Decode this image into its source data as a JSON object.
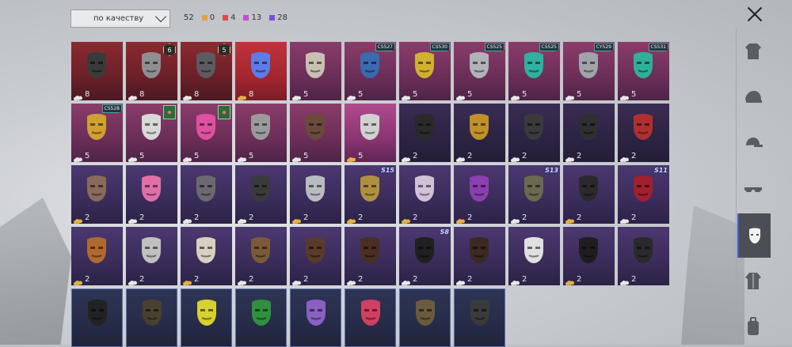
{
  "sort": {
    "label": "по качеству"
  },
  "counts": {
    "total": "52",
    "rarity": [
      {
        "value": "0",
        "color": "#e8a23a"
      },
      {
        "value": "4",
        "color": "#e04a4a"
      },
      {
        "value": "13",
        "color": "#c84ccf"
      },
      {
        "value": "28",
        "color": "#7a4ee0"
      }
    ]
  },
  "sidebar": {
    "categories": [
      {
        "name": "outfit-icon"
      },
      {
        "name": "helmet-icon"
      },
      {
        "name": "cap-icon"
      },
      {
        "name": "glasses-icon"
      },
      {
        "name": "mask-icon",
        "active": true
      },
      {
        "name": "jacket-icon"
      },
      {
        "name": "backpack-icon"
      }
    ]
  },
  "items": [
    {
      "rarity": "red",
      "count": "8",
      "icon": "respirator-mask-icon",
      "tone": "#3a3a3a"
    },
    {
      "rarity": "red",
      "count": "8",
      "icon": "plague-doctor-mask-icon",
      "tone": "#8e8e93",
      "lvl": "6"
    },
    {
      "rarity": "red",
      "count": "8",
      "icon": "gas-mask-icon",
      "tone": "#5b5b60",
      "lvl": "5"
    },
    {
      "rarity": "red-bright",
      "count": "8",
      "icon": "iridescent-mask-icon",
      "tone": "#5e7be8",
      "gold": true
    },
    {
      "rarity": "pink",
      "count": "5",
      "icon": "cat-mask-icon",
      "tone": "#c8c0b0"
    },
    {
      "rarity": "pink",
      "count": "5",
      "icon": "blue-respirator-icon",
      "tone": "#3a6ab0",
      "badge": "CS527"
    },
    {
      "rarity": "pink",
      "count": "5",
      "icon": "yellow-mask-icon",
      "tone": "#d0b030",
      "badge": "CS530"
    },
    {
      "rarity": "pink",
      "count": "5",
      "icon": "silver-mask-icon",
      "tone": "#b0b4b8",
      "badge": "CS525"
    },
    {
      "rarity": "pink",
      "count": "5",
      "icon": "teal-mask-icon",
      "tone": "#2fb0a0",
      "badge": "CS525"
    },
    {
      "rarity": "pink",
      "count": "5",
      "icon": "grey-mask-icon",
      "tone": "#a0a4a8",
      "badge": "CY529"
    },
    {
      "rarity": "pink",
      "count": "5",
      "icon": "green-mask-icon",
      "tone": "#30b098",
      "badge": "CS531"
    },
    {
      "rarity": "pink",
      "count": "5",
      "icon": "yellow-gas-mask-icon",
      "tone": "#d0a030",
      "badge": "CS528"
    },
    {
      "rarity": "pink",
      "count": "5",
      "icon": "x-mask-icon",
      "tone": "#d8d8d8",
      "green": true
    },
    {
      "rarity": "pink",
      "count": "5",
      "icon": "pink-mask-icon",
      "tone": "#e050a0",
      "green": true
    },
    {
      "rarity": "pink",
      "count": "5",
      "icon": "alien-mask-icon",
      "tone": "#9a9a9a"
    },
    {
      "rarity": "pink",
      "count": "5",
      "icon": "brown-mask-icon",
      "tone": "#6a4a38"
    },
    {
      "rarity": "magenta",
      "count": "5",
      "icon": "bandana-icon",
      "tone": "#d0d0d0",
      "gold": true
    },
    {
      "rarity": "purple",
      "count": "2",
      "icon": "black-mask-icon",
      "tone": "#2a2a2a"
    },
    {
      "rarity": "purple",
      "count": "2",
      "icon": "gold-eye-mask-icon",
      "tone": "#c0902a"
    },
    {
      "rarity": "purple",
      "count": "2",
      "icon": "dark-face-mask-icon",
      "tone": "#3a3a3c"
    },
    {
      "rarity": "purple",
      "count": "2",
      "icon": "tactical-mask-icon",
      "tone": "#2f2f32"
    },
    {
      "rarity": "purple",
      "count": "2",
      "icon": "red-eye-mask-icon",
      "tone": "#b03030"
    },
    {
      "rarity": "purple-light",
      "count": "2",
      "icon": "elephant-mask-icon",
      "tone": "#8a6a5a",
      "gold": true
    },
    {
      "rarity": "purple-light",
      "count": "2",
      "icon": "pink-dino-mask-icon",
      "tone": "#e070a8"
    },
    {
      "rarity": "purple-light",
      "count": "2",
      "icon": "hockey-mask-icon",
      "tone": "#6a6a70"
    },
    {
      "rarity": "purple-light",
      "count": "2",
      "icon": "goggle-mask-icon",
      "tone": "#3a3a3a"
    },
    {
      "rarity": "purple-light",
      "count": "2",
      "icon": "white-mask-icon",
      "tone": "#b8bcc0",
      "gold": true
    },
    {
      "rarity": "purple-light",
      "count": "2",
      "icon": "gold-skull-mask-icon",
      "tone": "#b09040",
      "gold": true,
      "season": "S15"
    },
    {
      "rarity": "purple-light",
      "count": "2",
      "icon": "half-mask-icon",
      "tone": "#d0c0d8",
      "gold": true
    },
    {
      "rarity": "purple-light",
      "count": "2",
      "icon": "purple-helmet-mask-icon",
      "tone": "#8a40b0",
      "gold": true
    },
    {
      "rarity": "purple-light",
      "count": "2",
      "icon": "goggles-mask-icon",
      "tone": "#6a6a50",
      "season": "S13"
    },
    {
      "rarity": "purple-light",
      "count": "2",
      "icon": "black-visor-mask-icon",
      "tone": "#2a2a2c",
      "gold": true
    },
    {
      "rarity": "purple-light",
      "count": "2",
      "icon": "red-visor-mask-icon",
      "tone": "#a02030",
      "season": "S11"
    },
    {
      "rarity": "purple-light",
      "count": "2",
      "icon": "copper-mask-icon",
      "tone": "#b06a30",
      "gold": true
    },
    {
      "rarity": "purple-light",
      "count": "2",
      "icon": "striped-mask-icon",
      "tone": "#c0c0c0"
    },
    {
      "rarity": "purple-light",
      "count": "2",
      "icon": "mummy-mask-icon",
      "tone": "#d8d0c0",
      "gold": true
    },
    {
      "rarity": "purple-light",
      "count": "2",
      "icon": "rusty-mask-icon",
      "tone": "#7a5a3a"
    },
    {
      "rarity": "purple-light",
      "count": "2",
      "icon": "leather-mask-icon",
      "tone": "#5a3a2a"
    },
    {
      "rarity": "purple-light",
      "count": "2",
      "icon": "mustache-icon",
      "tone": "#4a2e20"
    },
    {
      "rarity": "purple-light",
      "count": "2",
      "icon": "gold-trim-mask-icon",
      "tone": "#202020",
      "season": "S8"
    },
    {
      "rarity": "purple-light",
      "count": "2",
      "icon": "studded-mask-icon",
      "tone": "#3a2a20"
    },
    {
      "rarity": "purple-light",
      "count": "2",
      "icon": "camo-mask-icon",
      "tone": "#e0e0e0"
    },
    {
      "rarity": "purple-light",
      "count": "2",
      "icon": "black-helmet-mask-icon",
      "tone": "#1e1e20",
      "gold": true
    },
    {
      "rarity": "purple-light",
      "count": "2",
      "icon": "armored-mask-icon",
      "tone": "#2a2a2c"
    },
    {
      "rarity": "blue",
      "count": "",
      "icon": "black-bandana-icon",
      "tone": "#222"
    },
    {
      "rarity": "blue",
      "count": "",
      "icon": "skull-mask-icon",
      "tone": "#4a4030"
    },
    {
      "rarity": "blue",
      "count": "",
      "icon": "yellow-net-mask-icon",
      "tone": "#d8d030"
    },
    {
      "rarity": "blue",
      "count": "",
      "icon": "green-net-mask-icon",
      "tone": "#309040"
    },
    {
      "rarity": "blue",
      "count": "",
      "icon": "purple-theater-mask-icon",
      "tone": "#8a60c0"
    },
    {
      "rarity": "blue",
      "count": "",
      "icon": "red-theater-mask-icon",
      "tone": "#d04060"
    },
    {
      "rarity": "blue",
      "count": "",
      "icon": "metal-jaw-mask-icon",
      "tone": "#6a5a40"
    },
    {
      "rarity": "blue",
      "count": "",
      "icon": "wire-mask-icon",
      "tone": "#3a3a3a"
    }
  ]
}
